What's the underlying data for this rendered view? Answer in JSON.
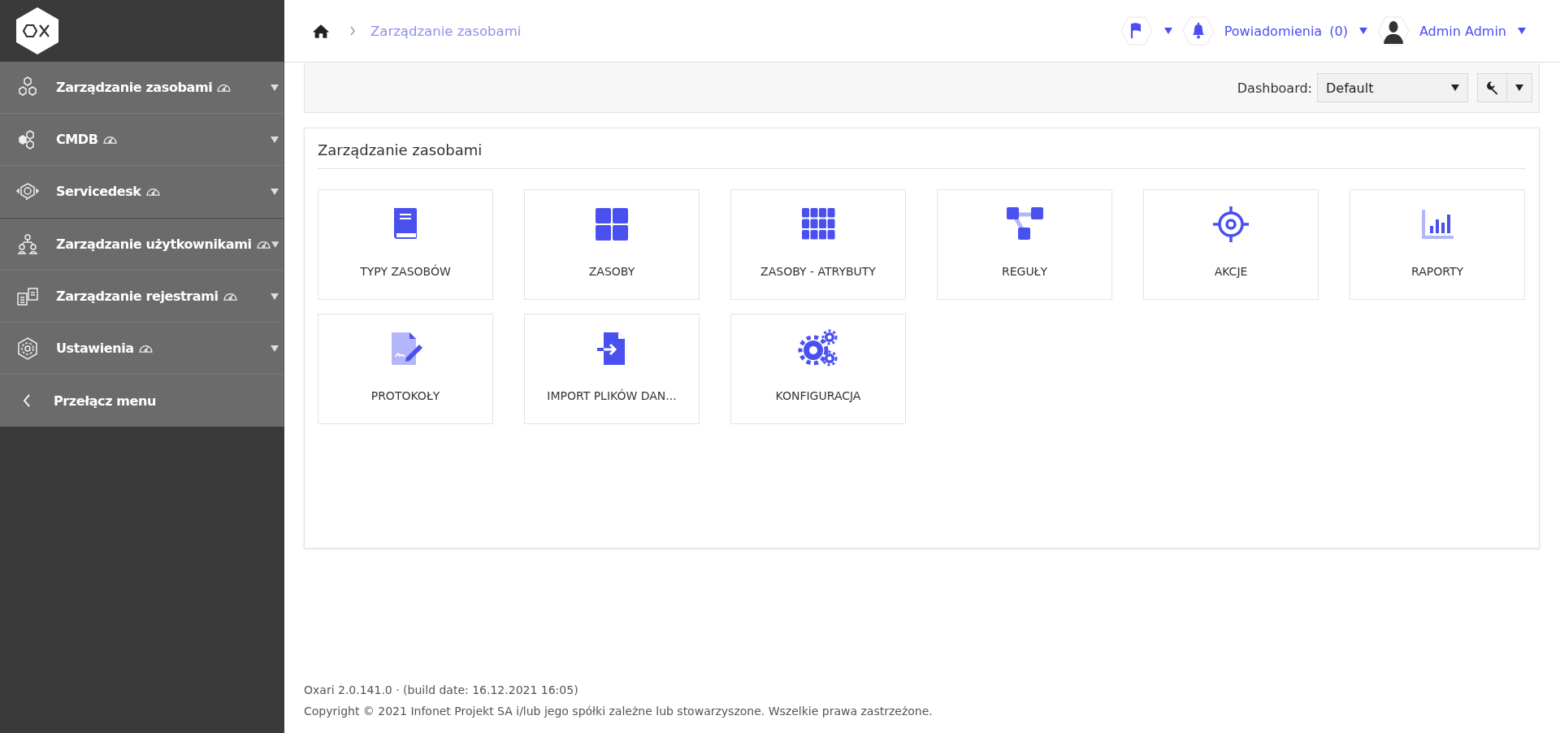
{
  "sidebar": {
    "items": [
      {
        "label": "Zarządzanie zasobami",
        "kind": "hexes",
        "divider_before": false
      },
      {
        "label": "CMDB",
        "kind": "cmdb",
        "divider_before": false
      },
      {
        "label": "Servicedesk",
        "kind": "headset",
        "divider_before": false
      },
      {
        "label": "Zarządzanie użytkownikami",
        "kind": "users",
        "divider_before": true
      },
      {
        "label": "Zarządzanie rejestrami",
        "kind": "docs",
        "divider_before": false
      },
      {
        "label": "Ustawienia",
        "kind": "gear",
        "divider_before": false
      }
    ],
    "toggle": "Przełącz menu"
  },
  "breadcrumb": [
    "Zarządzanie zasobami"
  ],
  "header": {
    "notifications": "Powiadomienia",
    "notification_count": "(0)",
    "user": "Admin Admin"
  },
  "toolbar": {
    "dashboard_label": "Dashboard:",
    "dashboard_value": "Default"
  },
  "panel": {
    "title": "Zarządzanie zasobami",
    "tiles": [
      {
        "label": "TYPY ZASOBÓW",
        "kind": "book"
      },
      {
        "label": "ZASOBY",
        "kind": "grid4"
      },
      {
        "label": "ZASOBY - ATRYBUTY",
        "kind": "grid9"
      },
      {
        "label": "REGUŁY",
        "kind": "rules"
      },
      {
        "label": "AKCJE",
        "kind": "target"
      },
      {
        "label": "RAPORTY",
        "kind": "chart"
      },
      {
        "label": "PROTOKOŁY",
        "kind": "sign"
      },
      {
        "label": "IMPORT PLIKÓW DAN...",
        "kind": "import"
      },
      {
        "label": "KONFIGURACJA",
        "kind": "gears"
      }
    ]
  },
  "footer": {
    "version": "Oxari 2.0.141.0",
    "separator": "·",
    "build": "(build date: 16.12.2021 16:05)",
    "copyright": "Copyright © 2021 Infonet Projekt SA i/lub jego spółki zależne lub stowarzyszone. Wszelkie prawa zastrzeżone."
  }
}
